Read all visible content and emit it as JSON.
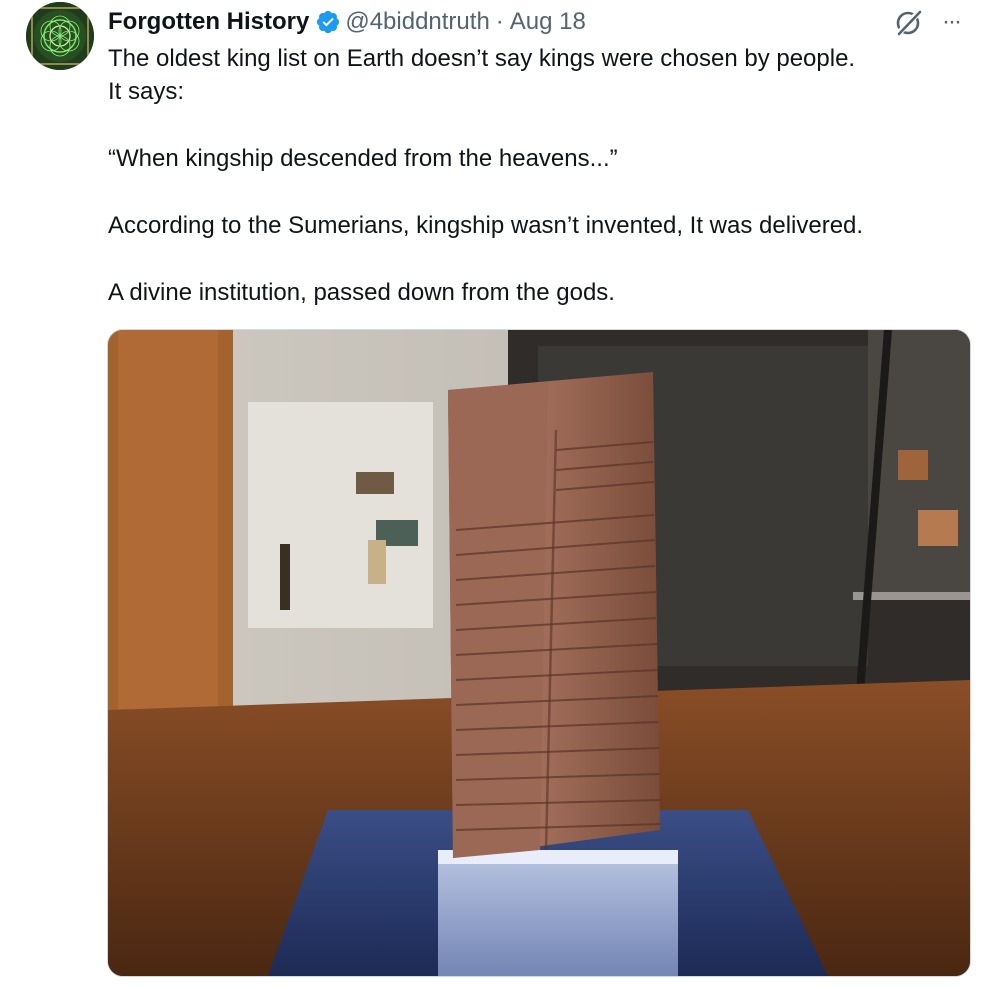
{
  "author": {
    "display_name": "Forgotten History",
    "handle": "@4biddntruth",
    "separator": "·",
    "date": "Aug 18",
    "avatar_icon": "sacred-geometry-avatar",
    "verified_icon": "verified-badge-icon"
  },
  "actions": {
    "grok_icon": "grok-icon",
    "more_icon": "more-options-icon",
    "more_label": "···"
  },
  "tweet": {
    "lines": [
      "The oldest king list on Earth doesn’t say kings were chosen by people.",
      "It says:",
      "",
      "“When kingship descended from the heavens...”",
      "",
      "According to the Sumerians, kingship wasn’t invented, It was delivered.",
      "",
      "A divine institution, passed down from the gods."
    ]
  },
  "media": {
    "alt": "",
    "colors": {
      "tablet": "#9c6a55",
      "floor": "#6b3a1e",
      "wall": "#d8d4cc",
      "display_case": "#2b2a28"
    }
  }
}
